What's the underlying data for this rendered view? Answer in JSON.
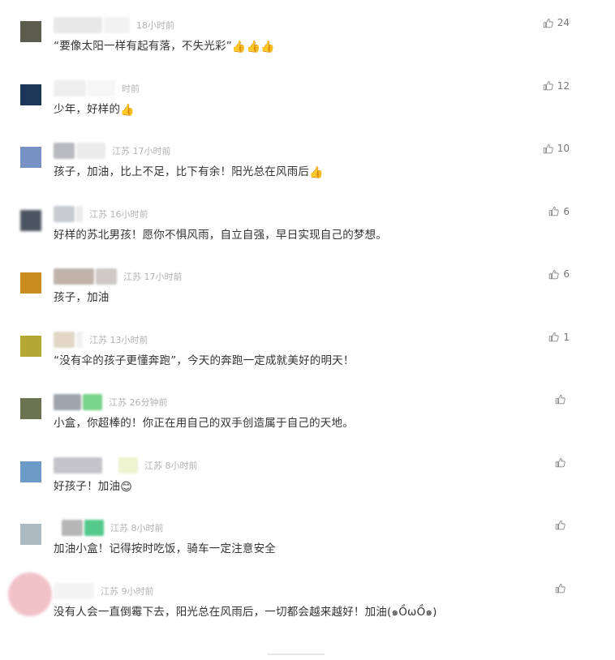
{
  "comments": [
    {
      "avatar_color": "#5b5c4e",
      "location": "18小时前",
      "text": "“要像太阳一样有起有落，不失光彩”",
      "emoji": [
        "👍",
        "👍",
        "👍"
      ],
      "likes": "24",
      "redact": [
        "#e8e8e8",
        "#f2f2f2"
      ]
    },
    {
      "avatar_color": "#1d3557",
      "location": "时前",
      "text": "少年，好样的",
      "emoji": [
        "👍"
      ],
      "likes": "12",
      "redact": [
        "#eeeeee",
        "#f5f5f5"
      ]
    },
    {
      "avatar_color": "#7891c4",
      "location": "江苏 17小时前",
      "text": "孩子，加油，比上不足，比下有余！阳光总在风雨后",
      "emoji": [
        "👍"
      ],
      "likes": "10",
      "redact": [
        "#b9b9c0",
        "#ececec"
      ]
    },
    {
      "avatar_color": "#4a5360",
      "location": "江苏 16小时前",
      "text": "好样的苏北男孩！愿你不惧风雨，自立自强，早日实现自己的梦想。",
      "emoji": [],
      "likes": "6",
      "redact": [
        "#c8ccd2",
        "#eaeaea"
      ]
    },
    {
      "avatar_color": "#c98a1e",
      "location": "江苏 17小时前",
      "text": "孩子，加油",
      "emoji": [],
      "likes": "6",
      "redact": [
        "#bfb3aa",
        "#cfc8c4"
      ]
    },
    {
      "avatar_color": "#b4a835",
      "location": "江苏 13小时前",
      "text": "“没有伞的孩子更懂奔跑”，今天的奔跑一定成就美好的明天！",
      "emoji": [],
      "likes": "1",
      "redact": [
        "#e2d7c6",
        "#f0f0f0"
      ]
    },
    {
      "avatar_color": "#6c7350",
      "location": "江苏 26分钟前",
      "text": "小盒，你超棒的！你正在用自己的双手创造属于自己的天地。",
      "emoji": [],
      "likes": "",
      "redact": [
        "#9ea5ad",
        "#78d48a"
      ]
    },
    {
      "avatar_color": "#6b9cc7",
      "location": "江苏 8小时前",
      "text": "好孩子！加油",
      "emoji": [
        "😊"
      ],
      "likes": "",
      "redact": [
        "#c5c4cc",
        "#eef3d0"
      ]
    },
    {
      "avatar_color": "#aebac2",
      "location": "江苏 8小时前",
      "text": "加油小盒！记得按时吃饭，骑车一定注意安全",
      "emoji": [],
      "likes": "",
      "redact": [
        "#b6b6b6",
        "#54c98c"
      ]
    },
    {
      "avatar_color": "#f1c1c8",
      "location": "江苏 9小时前",
      "text": "没有人会一直倒霉下去，阳光总在风雨后，一切都会越来越好！加油(๑ỒωỒ๑)",
      "emoji": [],
      "likes": "",
      "redact": [
        "#f4f4f4",
        "#f8f8f8"
      ]
    }
  ]
}
